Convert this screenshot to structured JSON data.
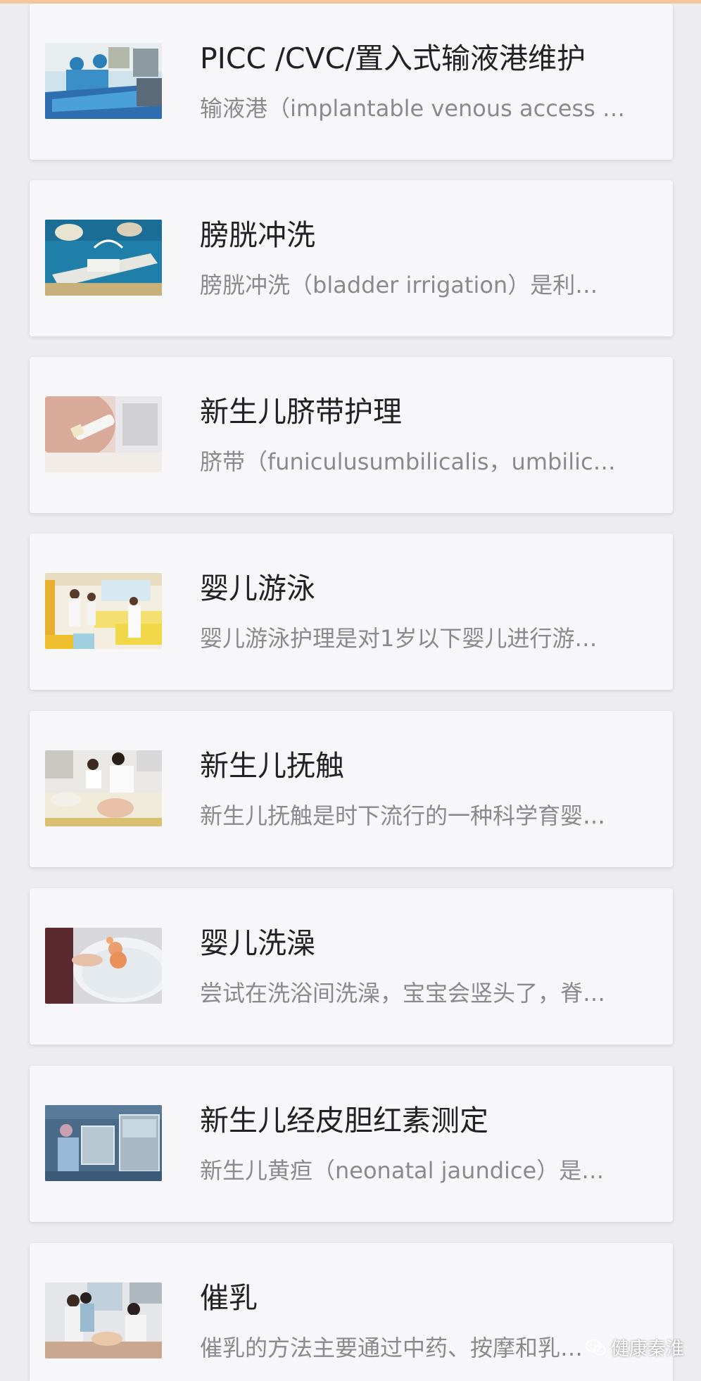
{
  "theme": {
    "accent": "#f3c79a",
    "background": "#ededf0",
    "card": "#f7f7f9",
    "title_color": "#222222",
    "desc_color": "#8a8a8a"
  },
  "items": [
    {
      "title": "PICC /CVC/置入式输液港维护",
      "desc": "输液港（implantable venous access …",
      "thumb_icon": "surgery-photo"
    },
    {
      "title": "膀胱冲洗",
      "desc": "膀胱冲洗（bladder irrigation）是利…",
      "thumb_icon": "procedure-photo"
    },
    {
      "title": "新生儿脐带护理",
      "desc": "脐带（funiculusumbilicalis，umbilic…",
      "thumb_icon": "umbilical-care-photo"
    },
    {
      "title": "婴儿游泳",
      "desc": "婴儿游泳护理是对1岁以下婴儿进行游…",
      "thumb_icon": "baby-swimming-photo"
    },
    {
      "title": "新生儿抚触",
      "desc": "新生儿抚触是时下流行的一种科学育婴…",
      "thumb_icon": "baby-massage-photo"
    },
    {
      "title": "婴儿洗澡",
      "desc": "尝试在洗浴间洗澡，宝宝会竖头了，脊…",
      "thumb_icon": "baby-bath-photo"
    },
    {
      "title": "新生儿经皮胆红素测定",
      "desc": "新生儿黄疸（neonatal jaundice）是…",
      "thumb_icon": "incubator-photo"
    },
    {
      "title": "催乳",
      "desc": "催乳的方法主要通过中药、按摩和乳…",
      "thumb_icon": "lactation-photo"
    }
  ],
  "watermark": {
    "text": "健康秦淮",
    "icon": "wechat-icon"
  }
}
